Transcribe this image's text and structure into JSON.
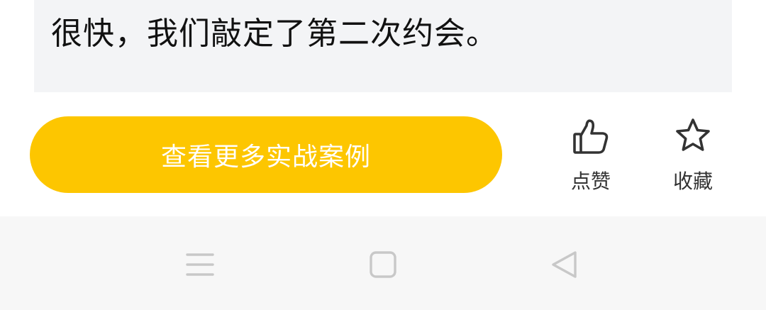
{
  "article": {
    "quote_text": "很快，我们敲定了第二次约会。"
  },
  "cta": {
    "label": "查看更多实战案例",
    "color": "#fdc600"
  },
  "actions": {
    "like_label": "点赞",
    "like_icon": "thumbs-up-icon",
    "favorite_label": "收藏",
    "favorite_icon": "star-icon"
  },
  "system_nav": {
    "menu_icon": "menu-icon",
    "home_icon": "home-square-icon",
    "back_icon": "back-triangle-icon"
  }
}
